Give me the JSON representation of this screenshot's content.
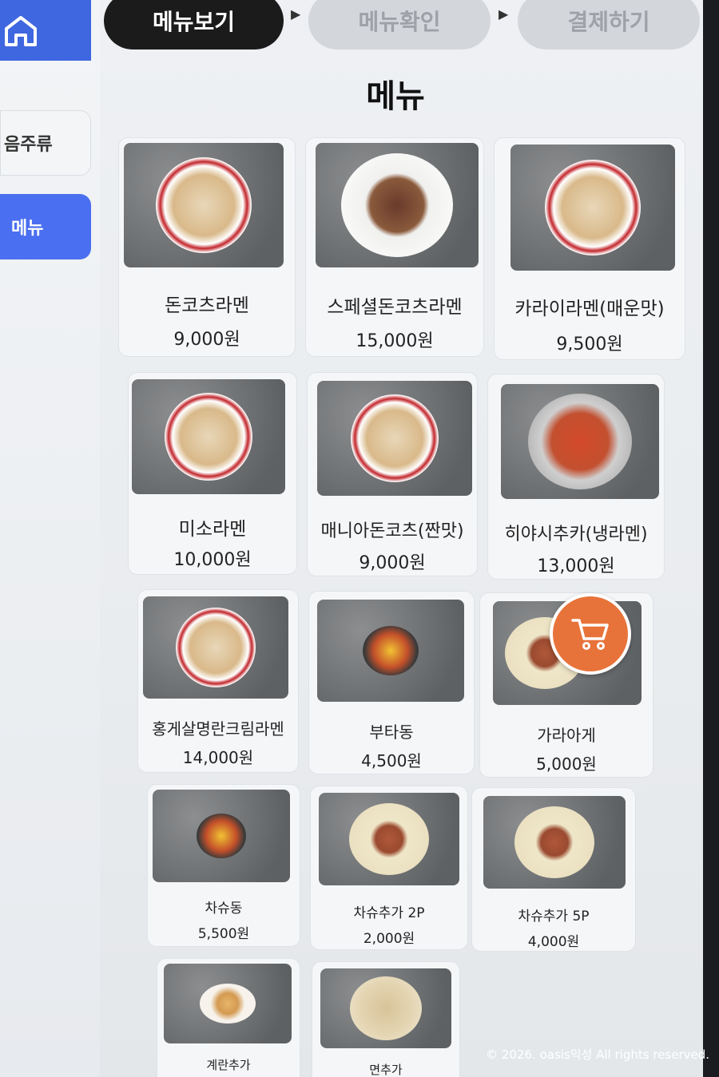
{
  "progress_steps": [
    {
      "label": "메뉴보기"
    },
    {
      "label": "메뉴확인"
    },
    {
      "label": "결제하기"
    }
  ],
  "sidebar": {
    "categories": [
      {
        "label": "음주류"
      },
      {
        "label": "메뉴"
      }
    ]
  },
  "page_title": "메뉴",
  "menu_items": [
    {
      "name": "돈코츠라멘",
      "price": "9,000원"
    },
    {
      "name": "스페셜돈코츠라멘",
      "price": "15,000원"
    },
    {
      "name": "카라이라멘(매운맛)",
      "price": "9,500원"
    },
    {
      "name": "미소라멘",
      "price": "10,000원"
    },
    {
      "name": "매니아돈코츠(짠맛)",
      "price": "9,000원"
    },
    {
      "name": "히야시추카(냉라멘)",
      "price": "13,000원"
    },
    {
      "name": "홍게살명란크림라멘",
      "price": "14,000원"
    },
    {
      "name": "부타동",
      "price": "4,500원"
    },
    {
      "name": "가라아게",
      "price": "5,000원"
    },
    {
      "name": "차슈동",
      "price": "5,500원"
    },
    {
      "name": "차슈추가 2P",
      "price": "2,000원"
    },
    {
      "name": "차슈추가 5P",
      "price": "4,000원"
    },
    {
      "name": "계란추가",
      "price": ""
    },
    {
      "name": "면추가",
      "price": ""
    }
  ],
  "copyright": "© 2026. oasis익성 All rights reserved.",
  "colors": {
    "accent_blue": "#4a6ff0",
    "cart_orange": "#e8733a",
    "active_step": "#1b1b1b"
  }
}
